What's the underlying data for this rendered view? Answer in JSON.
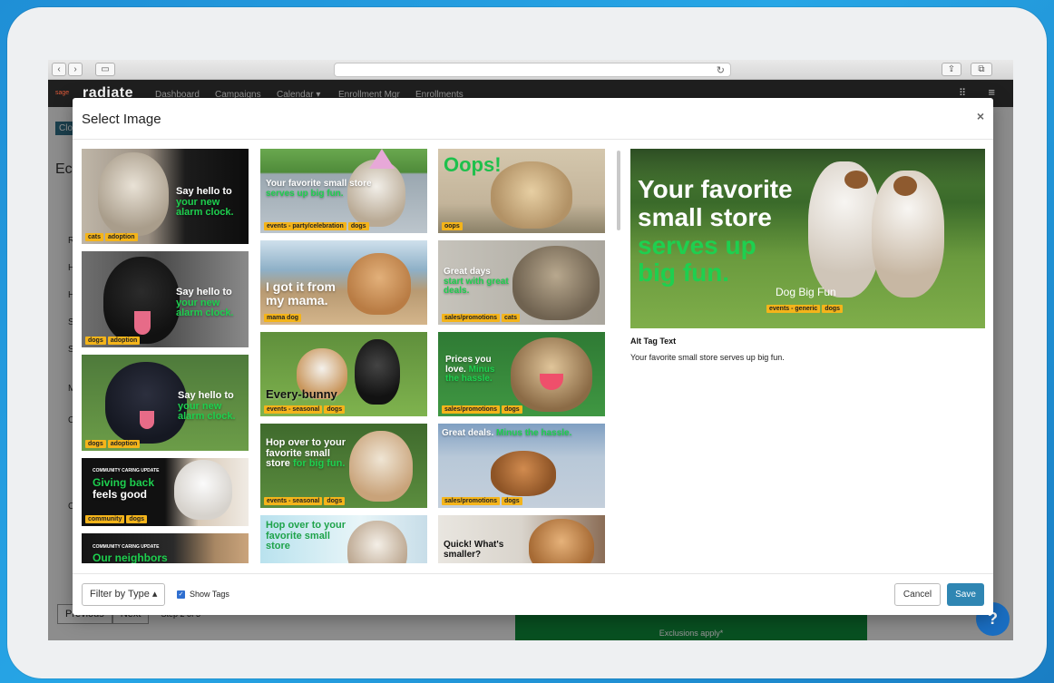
{
  "app": {
    "brand_pre": "sage",
    "brand": "radiate",
    "nav": [
      "Dashboard",
      "Campaigns",
      "Calendar ▾",
      "Enrollment Mgr",
      "Enrollments"
    ]
  },
  "background": {
    "close_fragment": "Clo",
    "heading_fragment": "Ec",
    "labels": [
      "R",
      "H",
      "H",
      "S",
      "S",
      "M",
      "C",
      "C"
    ],
    "pager_prev": "Previous",
    "pager_next": "Next",
    "pager_step": "Step 2 of 3",
    "green_note": "Exclusions apply*",
    "help": "?"
  },
  "modal": {
    "title": "Select Image",
    "close": "×",
    "preview": {
      "caption_white": "Your favorite small store",
      "caption_green": "serves up big fun.",
      "name": "Dog Big Fun",
      "tags": [
        "events - generic",
        "dogs"
      ]
    },
    "alt_label": "Alt Tag Text",
    "alt_text": "Your favorite small store serves up big fun.",
    "filter_label": "Filter by Type ▴",
    "show_tags_label": "Show Tags",
    "cancel_label": "Cancel",
    "save_label": "Save"
  },
  "gallery": {
    "col1": [
      {
        "white": "Say hello to",
        "green": "your new alarm clock.",
        "tags": [
          "cats",
          "adoption"
        ]
      },
      {
        "white": "Say hello to",
        "green": "your new alarm clock.",
        "tags": [
          "dogs",
          "adoption"
        ]
      },
      {
        "white": "Say hello to",
        "green": "your new alarm clock.",
        "tags": [
          "dogs",
          "adoption"
        ]
      },
      {
        "small": "COMMUNITY CARING UPDATE",
        "green": "Giving back",
        "white": "feels good",
        "tags": [
          "community",
          "dogs"
        ]
      },
      {
        "small": "COMMUNITY CARING UPDATE",
        "green": "Our neighbors",
        "tags": []
      }
    ],
    "col2": [
      {
        "white": "Your favorite small store",
        "green": "serves up big fun.",
        "tags": [
          "events - party/celebration",
          "dogs"
        ]
      },
      {
        "white": "I got it from my mama.",
        "tags": [
          "mama dog"
        ]
      },
      {
        "dark": "Every-bunny",
        "tags": [
          "events - seasonal",
          "dogs"
        ]
      },
      {
        "white": "Hop over to your favorite small store",
        "green": "for big fun.",
        "tags": [
          "events - seasonal",
          "dogs"
        ]
      },
      {
        "white": "Hop over to your favorite small store",
        "tags": []
      }
    ],
    "col3": [
      {
        "green": "Oops!",
        "tags": [
          "oops"
        ]
      },
      {
        "white": "Great days",
        "green": "start with great deals.",
        "tags": [
          "sales/promotions",
          "cats"
        ]
      },
      {
        "white": "Prices you love.",
        "green": "Minus the hassle.",
        "tags": [
          "sales/promotions",
          "dogs"
        ]
      },
      {
        "white": "Great deals.",
        "green": "Minus the hassle.",
        "tags": [
          "sales/promotions",
          "dogs"
        ]
      },
      {
        "dark": "Quick! What's smaller?",
        "tags": []
      }
    ]
  }
}
